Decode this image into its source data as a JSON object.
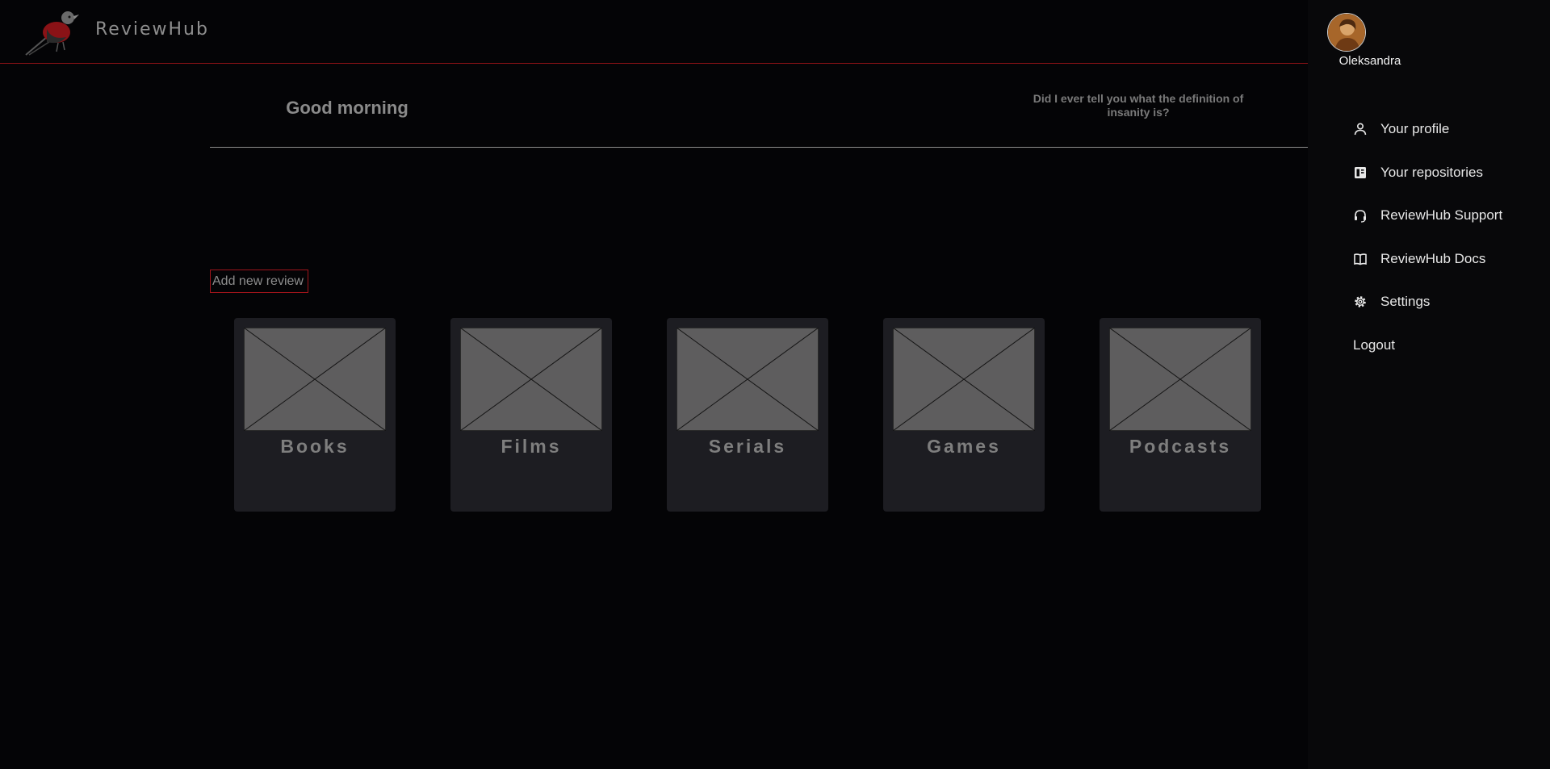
{
  "app": {
    "brand": "ReviewHub"
  },
  "main": {
    "greeting": "Good morning",
    "quote": "Did I ever tell you what the definition of insanity is?",
    "add_review_label": "Add new review",
    "categories": [
      {
        "label": "Books"
      },
      {
        "label": "Films"
      },
      {
        "label": "Serials"
      },
      {
        "label": "Games"
      },
      {
        "label": "Podcasts"
      }
    ]
  },
  "user_menu": {
    "username": "Oleksandra",
    "items": [
      {
        "label": "Your profile",
        "icon": "person-icon"
      },
      {
        "label": "Your repositories",
        "icon": "repository-icon"
      },
      {
        "label": "ReviewHub Support",
        "icon": "headset-icon"
      },
      {
        "label": "ReviewHub Docs",
        "icon": "book-icon"
      },
      {
        "label": "Settings",
        "icon": "gear-icon"
      },
      {
        "label": "Logout"
      }
    ]
  },
  "colors": {
    "accent": "#a0141a",
    "background": "#040406",
    "card": "#1d1d22",
    "placeholder": "#5e5d5e"
  }
}
